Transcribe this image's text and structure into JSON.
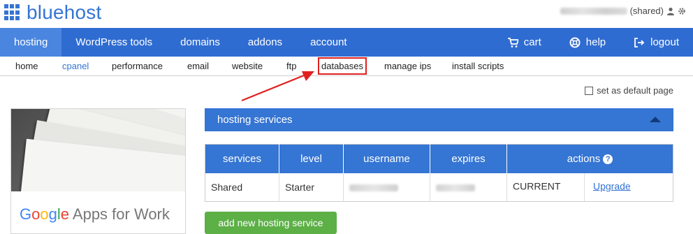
{
  "header": {
    "logo_text": "bluehost",
    "account_suffix": "(shared)"
  },
  "main_nav": {
    "items": [
      {
        "label": "hosting",
        "active": true
      },
      {
        "label": "WordPress tools"
      },
      {
        "label": "domains"
      },
      {
        "label": "addons"
      },
      {
        "label": "account"
      }
    ],
    "right_items": [
      {
        "label": "cart",
        "icon": "cart-icon"
      },
      {
        "label": "help",
        "icon": "lifebuoy-icon"
      },
      {
        "label": "logout",
        "icon": "logout-icon"
      }
    ]
  },
  "sub_nav": {
    "items": [
      {
        "label": "home"
      },
      {
        "label": "cpanel",
        "active": true
      },
      {
        "label": "performance"
      },
      {
        "label": "email"
      },
      {
        "label": "website"
      },
      {
        "label": "ftp"
      },
      {
        "label": "databases",
        "highlighted": true
      },
      {
        "label": "manage ips"
      },
      {
        "label": "install scripts"
      }
    ]
  },
  "default_page": {
    "label": "set as default page",
    "checked": false
  },
  "ad": {
    "brand_g": "Google",
    "brand_rest": " Apps for Work"
  },
  "hosting_panel": {
    "title": "hosting services"
  },
  "services_table": {
    "headers": [
      "services",
      "level",
      "username",
      "expires",
      "actions"
    ],
    "rows": [
      {
        "service": "Shared",
        "level": "Starter",
        "status": "CURRENT",
        "action": "Upgrade"
      }
    ]
  },
  "add_button": {
    "label": "add new hosting service"
  },
  "colors": {
    "brand_blue": "#3575d3",
    "nav_blue": "#2f6cd1",
    "green": "#5cb046",
    "highlight_red": "#e0201f"
  }
}
